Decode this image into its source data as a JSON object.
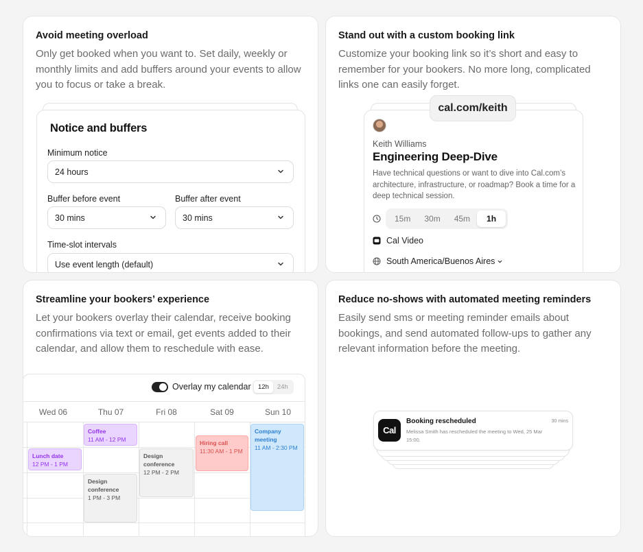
{
  "cards": {
    "overload": {
      "title": "Avoid meeting overload",
      "desc": "Only get booked when you want to. Set daily, weekly or monthly limits and add buffers around your events to allow you to focus or take a break.",
      "panel_title": "Notice and buffers",
      "min_notice_label": "Minimum notice",
      "min_notice_value": "24 hours",
      "buffer_before_label": "Buffer before event",
      "buffer_before_value": "30 mins",
      "buffer_after_label": "Buffer after event",
      "buffer_after_value": "30 mins",
      "interval_label": "Time-slot intervals",
      "interval_value": "Use event length (default)"
    },
    "booking_link": {
      "title": "Stand out with a custom booking link",
      "desc": "Customize your booking link so it’s short and easy to remember for your bookers. No more long, complicated links one can easily forget.",
      "url": "cal.com/keith",
      "host": "Keith Williams",
      "event_title": "Engineering Deep-Dive",
      "event_desc": "Have technical questions or want to dive into Cal.com’s architecture, infrastructure, or roadmap? Book a time for a deep technical session.",
      "durations": [
        "15m",
        "30m",
        "45m",
        "1h"
      ],
      "selected_duration": "1h",
      "location": "Cal Video",
      "timezone": "South America/Buenos Aires"
    },
    "experience": {
      "title": "Streamline your bookers’ experience",
      "desc": "Let your bookers overlay their calendar, receive booking confirmations via text or email, get events added to their calendar, and allow them to reschedule with ease.",
      "overlay_label": "Overlay my calendar",
      "overlay_on": true,
      "format_12": "12h",
      "format_24": "24h",
      "days": [
        "Wed 06",
        "Thu 07",
        "Fri 08",
        "Sat 09",
        "Sun 10"
      ],
      "events": [
        {
          "name": "Coffee",
          "time": "11 AM - 12 PM",
          "color": "#e9d5ff",
          "text": "#9333ea"
        },
        {
          "name": "Lunch date",
          "time": "12 PM - 1 PM",
          "color": "#e9d5ff",
          "text": "#9333ea"
        },
        {
          "name": "Design conference",
          "time": "12 PM - 2 PM",
          "color": "#f1f1f1",
          "text": "#555555"
        },
        {
          "name": "Design conference",
          "time": "1 PM - 3 PM",
          "color": "#f1f1f1",
          "text": "#555555"
        },
        {
          "name": "Hiring call",
          "time": "11:30 AM - 1 PM",
          "color": "#fecaca",
          "text": "#d9534f"
        },
        {
          "name": "Company meeting",
          "time": "11 AM - 2:30 PM",
          "color": "#cfe8fc",
          "text": "#2f80d1"
        }
      ]
    },
    "reminders": {
      "title": "Reduce no-shows with automated meeting reminders",
      "desc": "Easily send sms or meeting reminder emails about bookings, and send automated follow-ups to gather any relevant information before the meeting.",
      "logo": "Cal",
      "notif_title": "Booking rescheduled",
      "notif_time": "30 mins",
      "notif_body": "Melissa Smith has rescheduled the meeting to Wed, 25 Mar 15:00."
    }
  }
}
